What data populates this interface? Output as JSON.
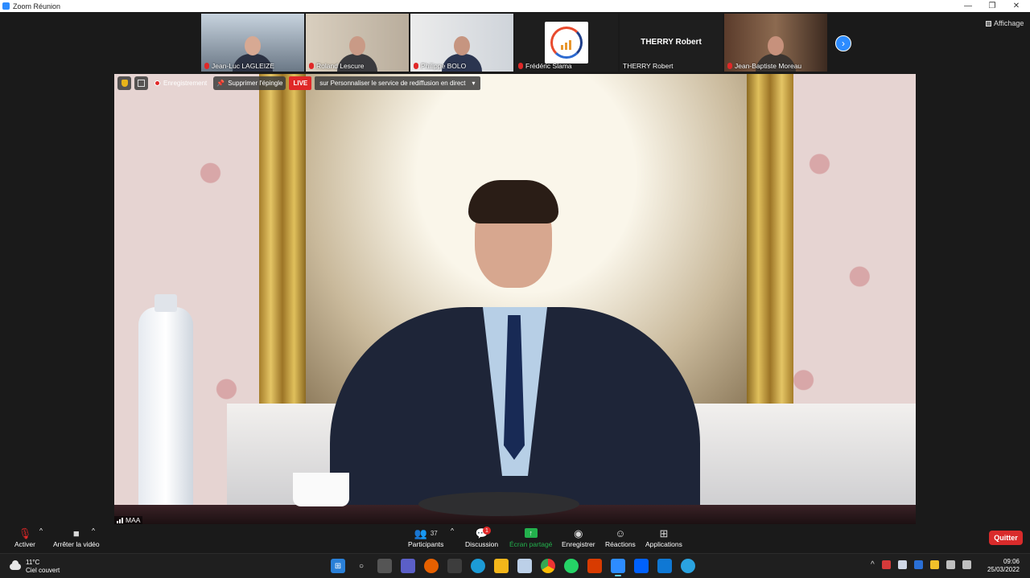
{
  "window": {
    "title": "Zoom Réunion",
    "controls": [
      "—",
      "❐",
      "✕"
    ]
  },
  "header": {
    "view_label": "Affichage"
  },
  "participants_strip": [
    {
      "name": "Jean-Luc LAGLEIZE",
      "muted": true,
      "type": "video"
    },
    {
      "name": "Roland Lescure",
      "muted": true,
      "type": "video"
    },
    {
      "name": "Philippe BOLO",
      "muted": true,
      "type": "video"
    },
    {
      "name": "Frédéric Slama",
      "muted": true,
      "type": "logo"
    },
    {
      "name": "THERRY Robert",
      "muted": false,
      "type": "name-only",
      "display_name": "THERRY Robert"
    },
    {
      "name": "Jean-Baptiste Moreau",
      "muted": true,
      "type": "video"
    }
  ],
  "main_video": {
    "overlay": {
      "recording_label": "Enregistrement",
      "unpin_label": "Supprimer l'épingle",
      "live_label": "LIVE",
      "live_info": "sur Personnaliser le service de rediffusion en direct"
    },
    "speaker_label": "MAA"
  },
  "toolbar": {
    "mute_label": "Activer",
    "video_label": "Arrêter la vidéo",
    "participants_label": "Participants",
    "participants_count": "37",
    "chat_label": "Discussion",
    "chat_badge": "1",
    "share_label": "Écran partagé",
    "record_label": "Enregistrer",
    "reactions_label": "Réactions",
    "apps_label": "Applications",
    "quit_label": "Quitter"
  },
  "taskbar": {
    "weather_temp": "11°C",
    "weather_desc": "Ciel couvert",
    "time": "09:06",
    "date": "25/03/2022",
    "apps": [
      "start-icon",
      "search-icon",
      "task-view-icon",
      "teams-icon",
      "firefox-icon",
      "store-icon",
      "edge-icon",
      "explorer-icon",
      "app-icon",
      "chrome-icon",
      "whatsapp-icon",
      "office-icon",
      "zoom-icon",
      "dropbox-icon",
      "outlook-icon",
      "telegram-icon"
    ]
  },
  "colors": {
    "accent_blue": "#2d8cff",
    "share_green": "#23b14d",
    "quit_red": "#d92b2b",
    "live_red": "#e02828"
  }
}
